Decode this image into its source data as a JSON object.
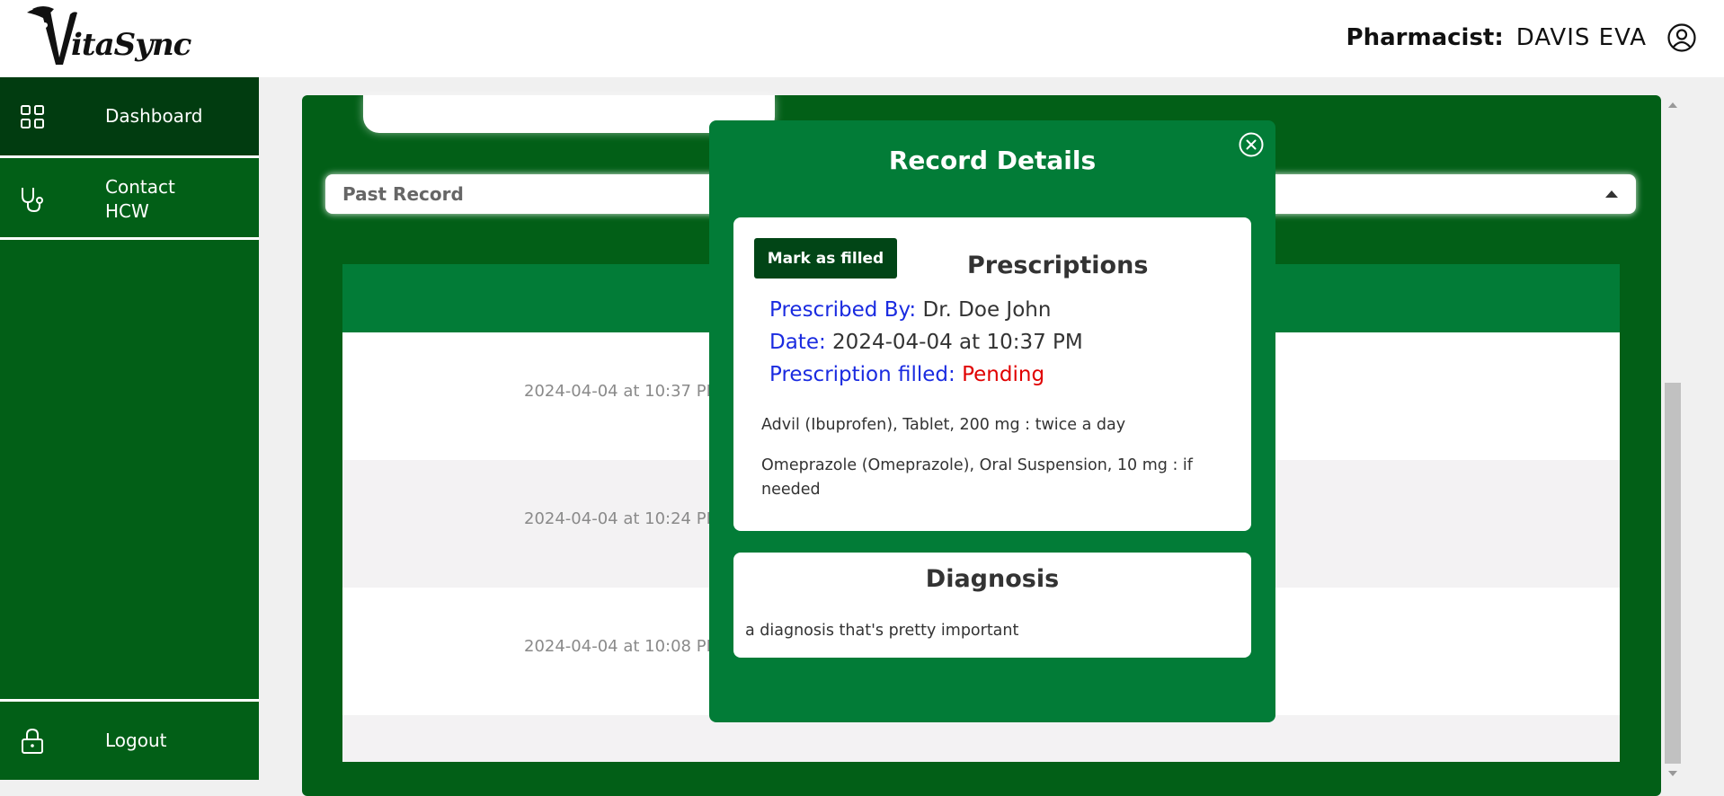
{
  "header": {
    "logo_text": "itaSync",
    "role_label": "Pharmacist:",
    "user_name": "DAVIS EVA"
  },
  "sidebar": {
    "items": [
      {
        "label": "Dashboard",
        "icon": "grid-icon"
      },
      {
        "label": "Contact HCW",
        "icon": "stethoscope-icon"
      },
      {
        "label": "Logout",
        "icon": "lock-icon"
      }
    ]
  },
  "main": {
    "past_record_label": "Past Record",
    "rows": [
      {
        "date": "2024-04-04 at 10:37 PM"
      },
      {
        "date": "2024-04-04 at 10:24 PM"
      },
      {
        "date": "2024-04-04 at 10:08 PM"
      }
    ]
  },
  "modal": {
    "title": "Record Details",
    "mark_button": "Mark as filled",
    "prescriptions_title": "Prescriptions",
    "prescribed_by_label": "Prescribed By:",
    "prescribed_by_value": "Dr. Doe John",
    "date_label": "Date:",
    "date_value": "2024-04-04 at 10:37 PM",
    "filled_label": "Prescription filled:",
    "filled_value": "Pending",
    "medications": [
      "Advil (Ibuprofen), Tablet, 200 mg : twice a day",
      "Omeprazole (Omeprazole), Oral Suspension, 10 mg : if needed"
    ],
    "diagnosis_title": "Diagnosis",
    "diagnosis_text": "a diagnosis that's pretty important"
  },
  "colors": {
    "primary_green": "#025f17",
    "dark_green": "#013c10",
    "accent_green": "#027c37",
    "label_blue": "#1a2be0",
    "pending_red": "#e00000"
  }
}
